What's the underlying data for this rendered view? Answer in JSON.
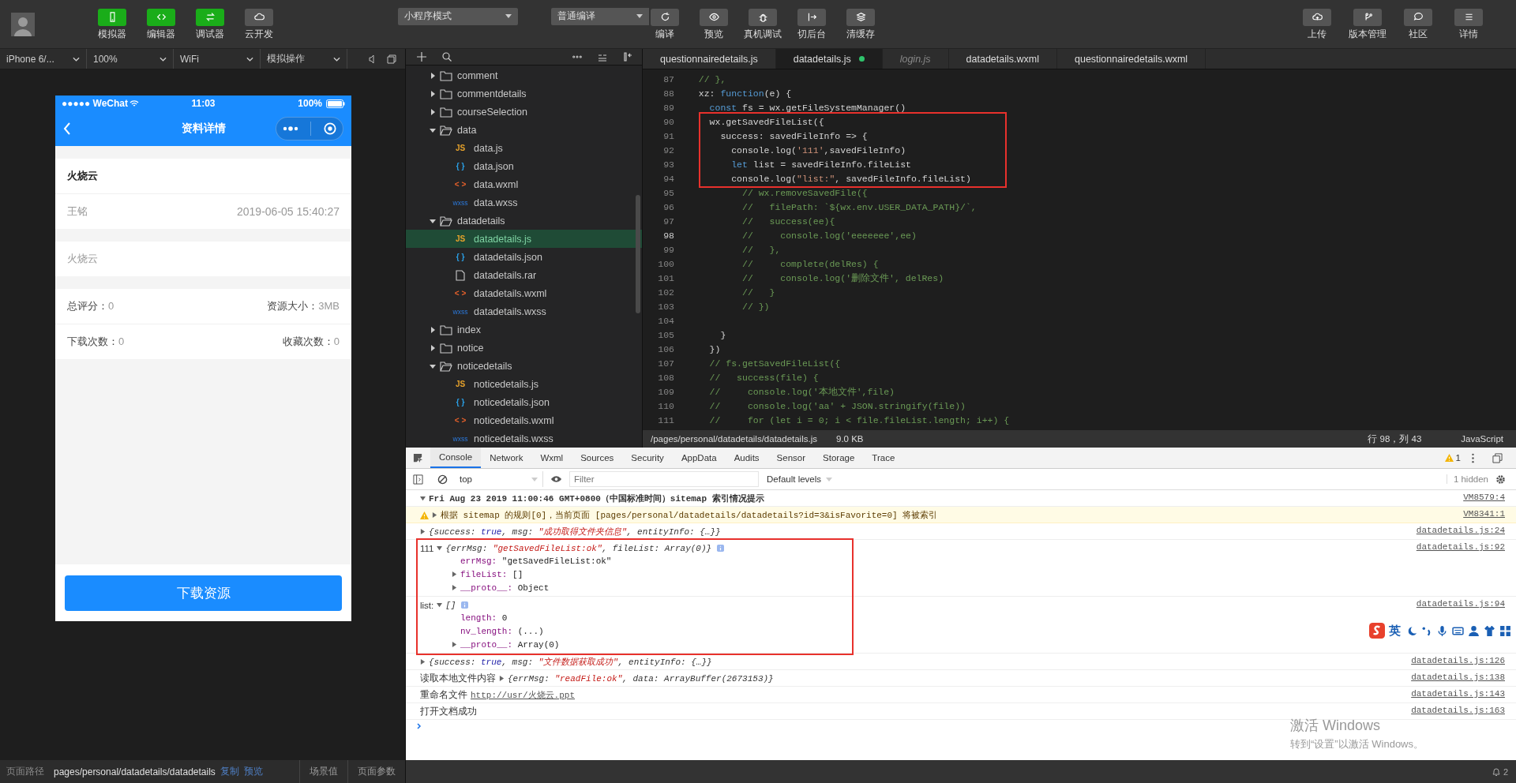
{
  "toolbar": {
    "toggles": [
      {
        "label": "模拟器",
        "selected": true
      },
      {
        "label": "编辑器",
        "selected": true
      },
      {
        "label": "调试器",
        "selected": true
      },
      {
        "label": "云开发",
        "selected": false
      }
    ],
    "mode_select": {
      "value": "小程序模式"
    },
    "compile_select": {
      "value": "普通编译"
    },
    "actions": [
      {
        "label": "编译"
      },
      {
        "label": "预览"
      },
      {
        "label": "真机调试"
      },
      {
        "label": "切后台"
      },
      {
        "label": "清缓存"
      }
    ],
    "right_actions": [
      {
        "label": "上传"
      },
      {
        "label": "版本管理"
      },
      {
        "label": "社区"
      },
      {
        "label": "详情"
      }
    ]
  },
  "simulator_bar": {
    "selects": [
      {
        "value": "iPhone 6/..."
      },
      {
        "value": "100%"
      },
      {
        "value": "WiFi"
      },
      {
        "value": "模拟操作"
      }
    ]
  },
  "phone": {
    "status": {
      "carrier": "●●●●● WeChat",
      "time": "11:03",
      "battery": "100%"
    },
    "nav_title": "资料详情",
    "title": "火烧云",
    "author": "王铭",
    "date": "2019-06-05 15:40:27",
    "description": "火烧云",
    "stat_rows": [
      {
        "left": {
          "label": "总评分：",
          "value": "0"
        },
        "right": {
          "label": "资源大小：",
          "value": "3MB"
        }
      },
      {
        "left": {
          "label": "下载次数：",
          "value": "0"
        },
        "right": {
          "label": "收藏次数：",
          "value": "0"
        }
      }
    ],
    "button": "下载资源"
  },
  "file_tree": [
    {
      "name": "comment",
      "kind": "folder",
      "expanded": false,
      "selected": false
    },
    {
      "name": "commentdetails",
      "kind": "folder",
      "expanded": false,
      "selected": false
    },
    {
      "name": "courseSelection",
      "kind": "folder",
      "expanded": false,
      "selected": false
    },
    {
      "name": "data",
      "kind": "folder",
      "expanded": true,
      "selected": false,
      "children": [
        {
          "name": "data.js",
          "kind": "js",
          "badge": "JS",
          "selected": false
        },
        {
          "name": "data.json",
          "kind": "json",
          "badge": "{ }",
          "selected": false
        },
        {
          "name": "data.wxml",
          "kind": "wxml",
          "badge": "< >",
          "selected": false
        },
        {
          "name": "data.wxss",
          "kind": "wxss",
          "badge": "wxss",
          "selected": false
        }
      ]
    },
    {
      "name": "datadetails",
      "kind": "folder",
      "expanded": true,
      "selected": false,
      "children": [
        {
          "name": "datadetails.js",
          "kind": "js",
          "badge": "JS",
          "selected": true
        },
        {
          "name": "datadetails.json",
          "kind": "json",
          "badge": "{ }",
          "selected": false
        },
        {
          "name": "datadetails.rar",
          "kind": "file",
          "selected": false
        },
        {
          "name": "datadetails.wxml",
          "kind": "wxml",
          "badge": "< >",
          "selected": false
        },
        {
          "name": "datadetails.wxss",
          "kind": "wxss",
          "badge": "wxss",
          "selected": false
        }
      ]
    },
    {
      "name": "index",
      "kind": "folder",
      "expanded": false,
      "selected": false
    },
    {
      "name": "notice",
      "kind": "folder",
      "expanded": false,
      "selected": false
    },
    {
      "name": "noticedetails",
      "kind": "folder",
      "expanded": true,
      "selected": false,
      "children": [
        {
          "name": "noticedetails.js",
          "kind": "js",
          "badge": "JS",
          "selected": false
        },
        {
          "name": "noticedetails.json",
          "kind": "json",
          "badge": "{ }",
          "selected": false
        },
        {
          "name": "noticedetails.wxml",
          "kind": "wxml",
          "badge": "< >",
          "selected": false
        },
        {
          "name": "noticedetails.wxss",
          "kind": "wxss",
          "badge": "wxss",
          "selected": false
        }
      ]
    }
  ],
  "editor": {
    "tabs": [
      {
        "label": "questionnairedetails.js",
        "selected": false,
        "modified": false,
        "preview": false
      },
      {
        "label": "datadetails.js",
        "selected": true,
        "modified": true,
        "preview": false
      },
      {
        "label": "login.js",
        "selected": false,
        "modified": false,
        "preview": true
      },
      {
        "label": "datadetails.wxml",
        "selected": false,
        "modified": false,
        "preview": false
      },
      {
        "label": "questionnairedetails.wxml",
        "selected": false,
        "modified": false,
        "preview": false
      }
    ],
    "lines": [
      {
        "number": "87",
        "kind": "comment",
        "text": "  // },",
        "current": false,
        "boxed": false
      },
      {
        "number": "88",
        "kind": "code",
        "text": "  xz: function(e) {",
        "current": false,
        "boxed": false
      },
      {
        "number": "89",
        "kind": "code",
        "text": "    const fs = wx.getFileSystemManager()",
        "current": false,
        "boxed": false
      },
      {
        "number": "90",
        "kind": "code",
        "text": "    wx.getSavedFileList({",
        "current": false,
        "boxed": true
      },
      {
        "number": "91",
        "kind": "code",
        "text": "      success: savedFileInfo => {",
        "current": false,
        "boxed": true
      },
      {
        "number": "92",
        "kind": "code",
        "text": "        console.log('111',savedFileInfo)",
        "current": false,
        "boxed": true
      },
      {
        "number": "93",
        "kind": "code",
        "text": "        let list = savedFileInfo.fileList",
        "current": false,
        "boxed": true
      },
      {
        "number": "94",
        "kind": "code",
        "text": "        console.log(\"list:\", savedFileInfo.fileList)",
        "current": false,
        "boxed": true
      },
      {
        "number": "95",
        "kind": "comment",
        "text": "          // wx.removeSavedFile({",
        "current": false,
        "boxed": false
      },
      {
        "number": "96",
        "kind": "comment",
        "text": "          //   filePath: `${wx.env.USER_DATA_PATH}/`,",
        "current": false,
        "boxed": false
      },
      {
        "number": "97",
        "kind": "comment",
        "text": "          //   success(ee){",
        "current": false,
        "boxed": false
      },
      {
        "number": "98",
        "kind": "comment",
        "text": "          //     console.log('eeeeeee',ee)",
        "current": true,
        "boxed": false
      },
      {
        "number": "99",
        "kind": "comment",
        "text": "          //   },",
        "current": false,
        "boxed": false
      },
      {
        "number": "100",
        "kind": "comment",
        "text": "          //     complete(delRes) {",
        "current": false,
        "boxed": false
      },
      {
        "number": "101",
        "kind": "comment",
        "text": "          //     console.log('删除文件', delRes)",
        "current": false,
        "boxed": false
      },
      {
        "number": "102",
        "kind": "comment",
        "text": "          //   }",
        "current": false,
        "boxed": false
      },
      {
        "number": "103",
        "kind": "comment",
        "text": "          // })",
        "current": false,
        "boxed": false
      },
      {
        "number": "104",
        "current": false,
        "boxed": false
      },
      {
        "number": "105",
        "kind": "code",
        "text": "      }",
        "current": false,
        "boxed": false
      },
      {
        "number": "106",
        "kind": "code",
        "text": "    })",
        "current": false,
        "boxed": false
      },
      {
        "number": "107",
        "kind": "comment",
        "text": "    // fs.getSavedFileList({",
        "current": false,
        "boxed": false
      },
      {
        "number": "108",
        "kind": "comment",
        "text": "    //   success(file) {",
        "current": false,
        "boxed": false
      },
      {
        "number": "109",
        "kind": "comment",
        "text": "    //     console.log('本地文件',file)",
        "current": false,
        "boxed": false
      },
      {
        "number": "110",
        "kind": "comment",
        "text": "    //     console.log('aa' + JSON.stringify(file))",
        "current": false,
        "boxed": false
      },
      {
        "number": "111",
        "kind": "comment",
        "text": "    //     for (let i = 0; i < file.fileList.length; i++) {",
        "current": false,
        "boxed": false
      }
    ],
    "status": {
      "path": "/pages/personal/datadetails/datadetails.js",
      "size": "9.0 KB",
      "position": "行 98，列 43",
      "language": "JavaScript"
    }
  },
  "devtools": {
    "tabs": [
      {
        "label": "Console",
        "selected": true
      },
      {
        "label": "Network",
        "selected": false
      },
      {
        "label": "Wxml",
        "selected": false
      },
      {
        "label": "Sources",
        "selected": false
      },
      {
        "label": "Security",
        "selected": false
      },
      {
        "label": "AppData",
        "selected": false
      },
      {
        "label": "Audits",
        "selected": false
      },
      {
        "label": "Sensor",
        "selected": false
      },
      {
        "label": "Storage",
        "selected": false
      },
      {
        "label": "Trace",
        "selected": false
      }
    ],
    "warning_count": "1",
    "context": "top",
    "filter": {
      "placeholder": "Filter"
    },
    "levels": "Default levels",
    "hidden": "1 hidden",
    "entries": [
      {
        "kind": "group",
        "text": "Fri Aug 23 2019 11:00:46 GMT+0800（中国标准时间）sitemap 索引情况提示",
        "expanded": true,
        "boxed": false,
        "source": "VM8579:4"
      },
      {
        "kind": "warning",
        "text": "根据 sitemap 的规则[0]，当前页面 [pages/personal/datadetails/datadetails?id=3&isFavorite=0] 将被索引",
        "expanded": false,
        "boxed": false,
        "source": "VM8341:1"
      },
      {
        "kind": "object",
        "summary": "{success: true, msg: \"成功取得文件夹信息\", entityInfo: {…}}",
        "expanded": false,
        "boxed": false,
        "source": "datadetails.js:24"
      },
      {
        "kind": "object",
        "label": "111",
        "summary": "{errMsg: \"getSavedFileList:ok\", fileList: Array(0)}",
        "expanded": true,
        "boxed": true,
        "source": "datadetails.js:92",
        "children": [
          {
            "key": "errMsg:",
            "value": "\"getSavedFileList:ok\"",
            "expandable": false
          },
          {
            "key": "fileList:",
            "value": "[]",
            "expandable": true
          },
          {
            "key": "__proto__:",
            "value": "Object",
            "expandable": true
          }
        ]
      },
      {
        "kind": "object",
        "label": "list:",
        "summary": "[]",
        "expanded": true,
        "boxed": true,
        "source": "datadetails.js:94",
        "children": [
          {
            "key": "length:",
            "value": "0",
            "expandable": false
          },
          {
            "key": "nv_length:",
            "value": "(...)",
            "expandable": false
          },
          {
            "key": "__proto__:",
            "value": "Array(0)",
            "expandable": true
          }
        ]
      },
      {
        "kind": "object",
        "summary": "{success: true, msg: \"文件数据获取成功\", entityInfo: {…}}",
        "expanded": false,
        "boxed": false,
        "source": "datadetails.js:126"
      },
      {
        "kind": "object",
        "label": "读取本地文件内容",
        "summary": "{errMsg: \"readFile:ok\", data: ArrayBuffer(2673153)}",
        "expanded": false,
        "boxed": false,
        "source": "datadetails.js:138"
      },
      {
        "kind": "link",
        "label": "重命名文件",
        "link": "http://usr/火烧云.ppt",
        "boxed": false,
        "source": "datadetails.js:143"
      },
      {
        "kind": "text",
        "label": "打开文档成功",
        "boxed": false,
        "source": "datadetails.js:163"
      }
    ]
  },
  "ime_toolbar": {
    "label": "英"
  },
  "activation_notice": {
    "title": "激活 Windows",
    "text": "转到“设置”以激活 Windows。"
  },
  "status_bar": {
    "label": "页面路径",
    "path": "pages/personal/datadetails/datadetails",
    "copy": "复制",
    "preview": "预览",
    "scene": "场景值",
    "params": "页面参数",
    "notifications": "2"
  }
}
